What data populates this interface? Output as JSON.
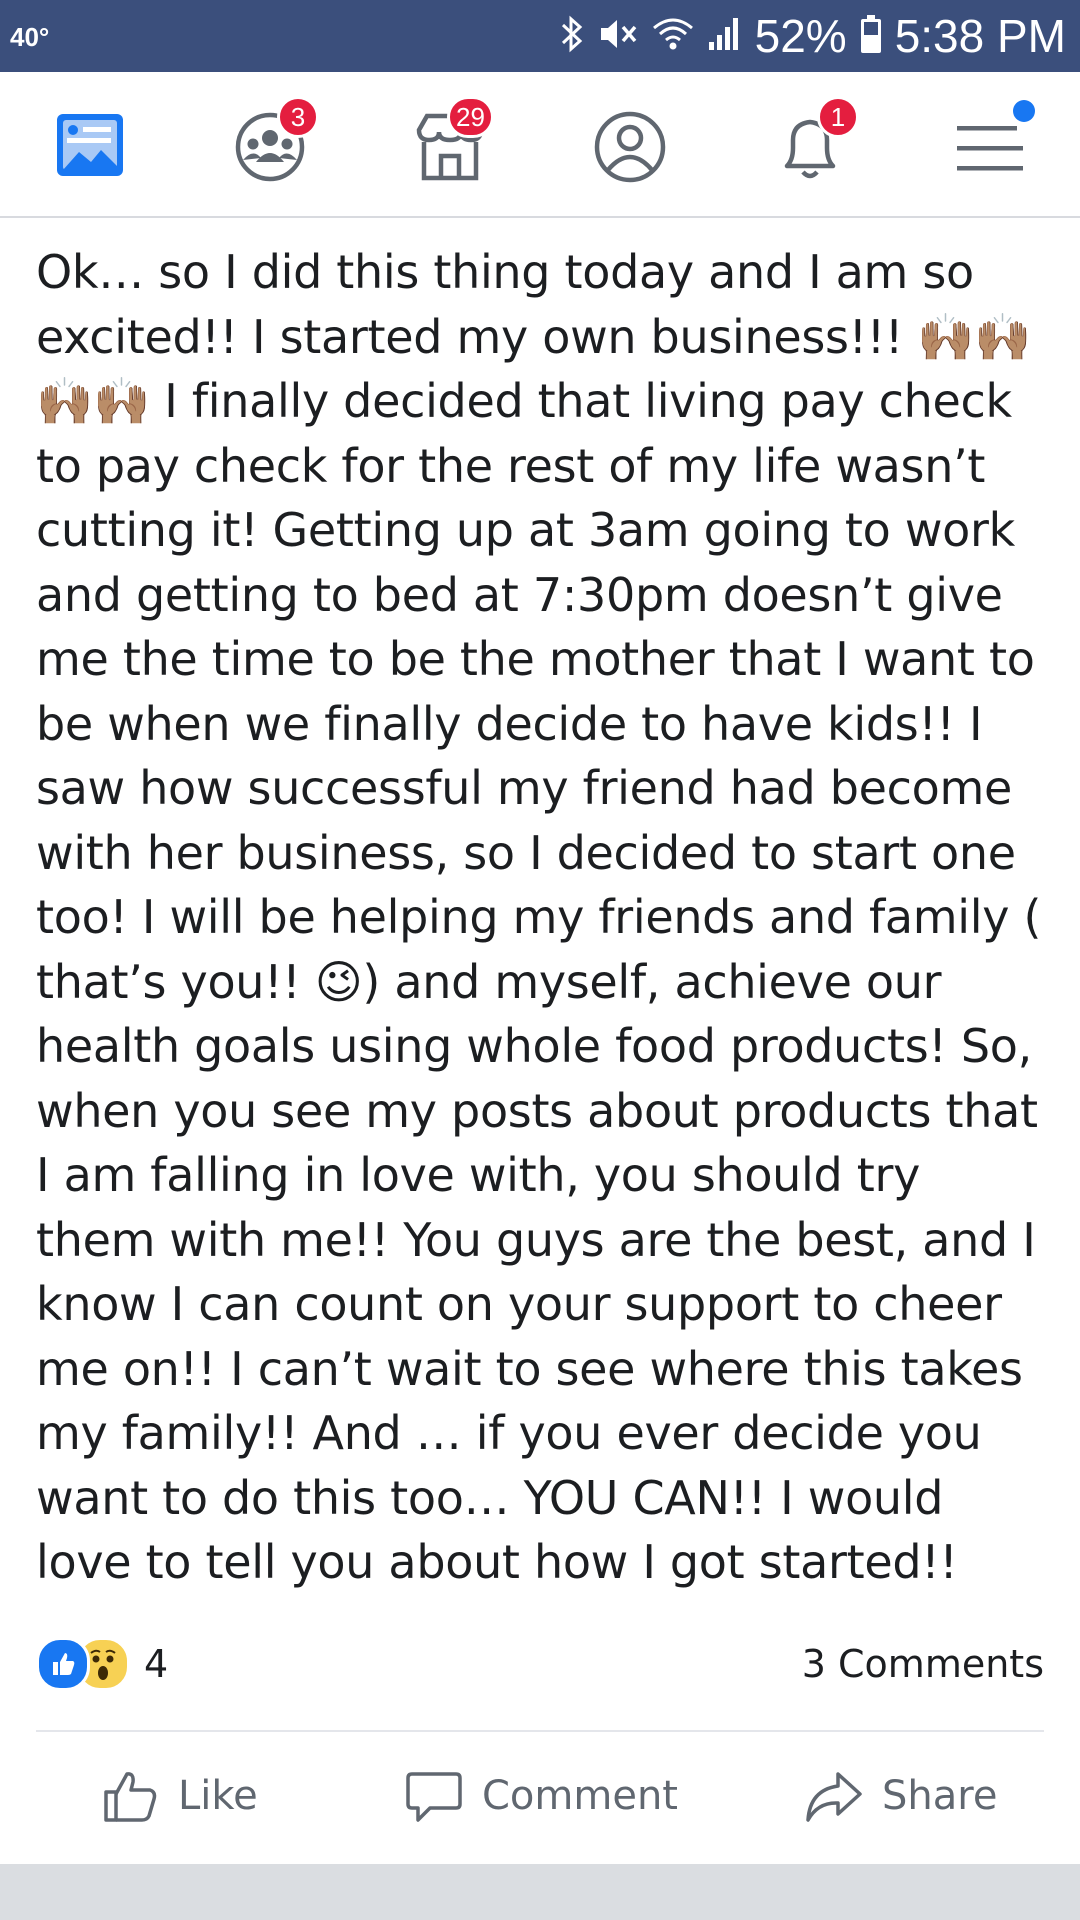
{
  "status_bar": {
    "temperature": "40°",
    "battery_percent": "52%",
    "time": "5:38 PM",
    "icons": [
      "bluetooth-icon",
      "mute-icon",
      "wifi-icon",
      "signal-icon",
      "battery-icon"
    ]
  },
  "nav": {
    "items": [
      {
        "name": "news-feed",
        "icon": "news-feed-icon",
        "badge": ""
      },
      {
        "name": "groups",
        "icon": "groups-icon",
        "badge": "3"
      },
      {
        "name": "marketplace",
        "icon": "marketplace-icon",
        "badge": "29"
      },
      {
        "name": "profile",
        "icon": "profile-icon",
        "badge": ""
      },
      {
        "name": "notifications",
        "icon": "bell-icon",
        "badge": "1"
      },
      {
        "name": "menu",
        "icon": "menu-icon",
        "badge": ""
      }
    ],
    "accent_color": "#1877f2",
    "badge_color": "#e41e3f"
  },
  "post": {
    "text": "Ok… so I did this thing today and I am so excited!! I started my own business!!! 🙌🏽🙌🏽🙌🏽🙌🏽 I finally decided that living pay check to pay check for the rest of my life wasn’t cutting it!  Getting up at 3am going to work and getting to bed at 7:30pm doesn’t give me the time to be the mother that I want to be when we finally decide to have kids!! I saw how successful my friend had become with her business, so I decided to start one too! I will be helping my friends and family ( that’s you!! 😉) and myself, achieve our health goals using whole food products! So, when you see my posts about products that I am falling in love with, you should try them with me!! You guys are the best, and I know I can count on your support to cheer me on!! I can’t wait to see where this takes my family!! And … if you ever decide you want to do this too… YOU CAN!! I would love to tell you about how I got started!!",
    "reactions": {
      "types": [
        "like",
        "wow"
      ],
      "count": "4"
    },
    "comments_label": "3 Comments"
  },
  "actions": {
    "like": "Like",
    "comment": "Comment",
    "share": "Share"
  }
}
